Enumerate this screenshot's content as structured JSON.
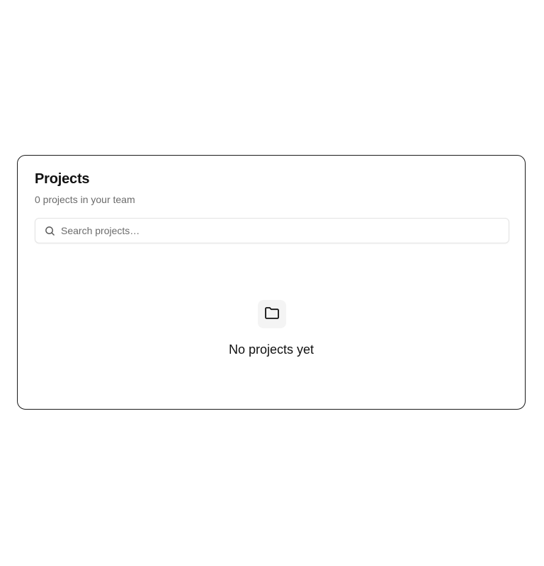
{
  "header": {
    "title": "Projects",
    "subtitle": "0 projects in your team"
  },
  "search": {
    "placeholder": "Search projects…",
    "value": "",
    "icon": "search-icon"
  },
  "empty_state": {
    "icon": "folder-icon",
    "message": "No projects yet"
  },
  "colors": {
    "card_border": "#1a1a1a",
    "text_primary": "#111111",
    "text_muted": "#6b6b6b",
    "icon_bg": "#f4f4f4"
  }
}
